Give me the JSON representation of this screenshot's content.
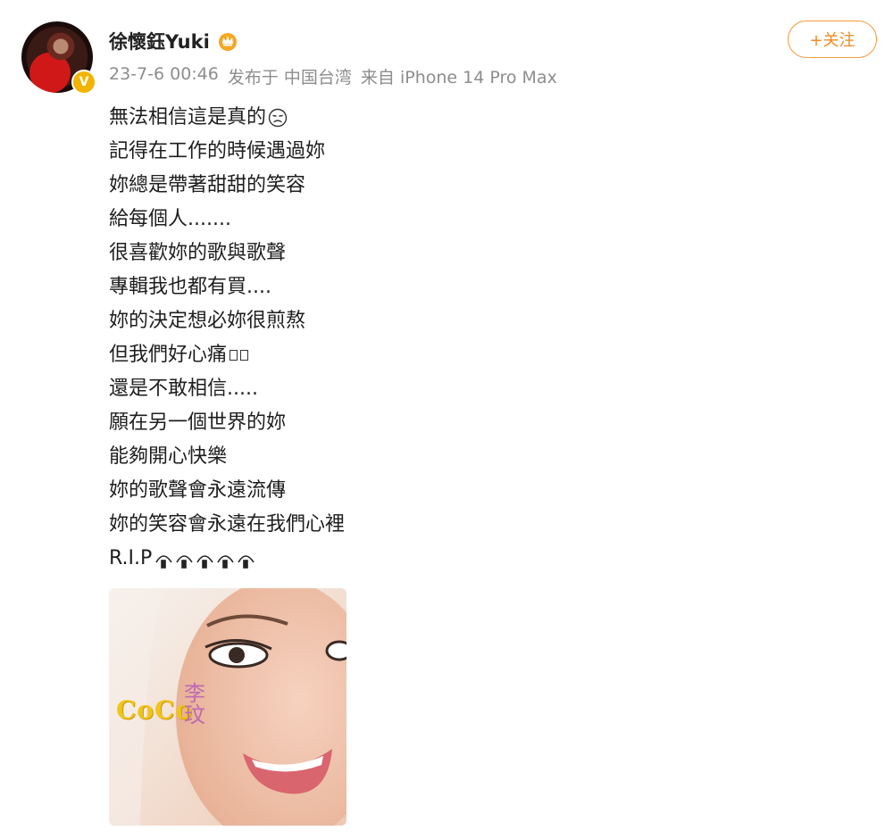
{
  "user": {
    "name": "徐懷鈺Yuki",
    "verified_badge": "V",
    "crown_icon": "crown-icon"
  },
  "meta": {
    "datetime": "23-7-6 00:46",
    "location": "发布于 中国台湾",
    "device": "来自 iPhone 14 Pro Max"
  },
  "follow_button": {
    "label": "+关注"
  },
  "post": {
    "lines": [
      "無法相信這是真的",
      "記得在工作的時候遇過妳",
      "妳總是帶著甜甜的笑容",
      "給每個人.......",
      "很喜歡妳的歌與歌聲",
      "專輯我也都有買....",
      "妳的決定想必妳很煎熬",
      "但我們好心痛",
      "還是不敢相信.....",
      "願在另一個世界的妳",
      "能夠開心快樂",
      "妳的歌聲會永遠流傳",
      "妳的笑容會永遠在我們心裡",
      "R.I.P"
    ]
  },
  "album": {
    "coco_text": "CoCo",
    "chinese_name": "李玟"
  },
  "colors": {
    "accent_orange": "#f08a24",
    "badge_yellow": "#f2b400",
    "meta_gray": "#8d8d8d"
  }
}
